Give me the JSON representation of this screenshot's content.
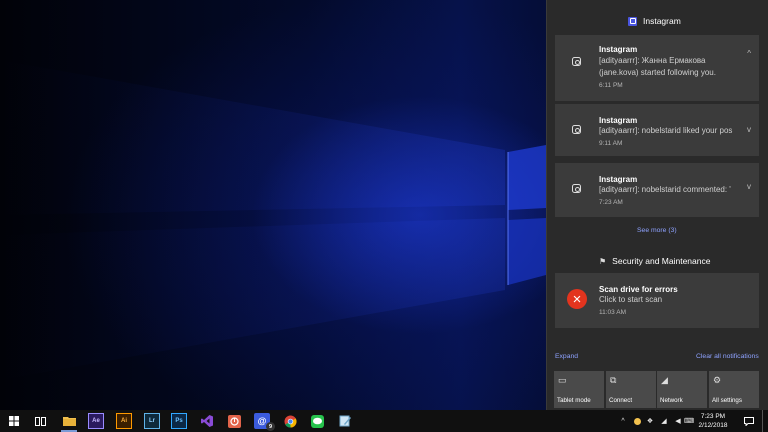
{
  "action_center": {
    "group_instagram": {
      "name": "Instagram",
      "icon": "instagram-app-icon"
    },
    "notifications": [
      {
        "app": "Instagram",
        "line1": "[adityaarrr]: Жанна Ермакова",
        "line2": "(jane.kova) started following you.",
        "time": "6:11 PM",
        "chevron": "^"
      },
      {
        "app": "Instagram",
        "line1": "[adityaarrr]: nobelstarid liked your pos",
        "line2": "",
        "time": "9:11 AM",
        "chevron": "v"
      },
      {
        "app": "Instagram",
        "line1": "[adityaarrr]: nobelstarid commented: '",
        "line2": "",
        "time": "7:23 AM",
        "chevron": "v"
      }
    ],
    "see_more": "See more (3)",
    "group_security": {
      "name": "Security and Maintenance",
      "icon": "flag-icon"
    },
    "security_notification": {
      "title": "Scan drive for errors",
      "body": "Click to start scan",
      "time": "11:03 AM"
    },
    "expand": "Expand",
    "clear_all": "Clear all notifications",
    "quick_actions": [
      {
        "label": "Tablet mode",
        "icon": "tablet-mode-icon"
      },
      {
        "label": "Connect",
        "icon": "connect-icon"
      },
      {
        "label": "Network",
        "icon": "network-icon"
      },
      {
        "label": "All settings",
        "icon": "gear-icon"
      }
    ]
  },
  "taskbar": {
    "apps": [
      {
        "name": "start",
        "icon": "windows-logo-icon",
        "glyph": "",
        "color": "#ffffff"
      },
      {
        "name": "task-view",
        "icon": "task-view-icon",
        "glyph": "",
        "color": "#ffffff"
      },
      {
        "name": "file-explorer",
        "icon": "folder-icon",
        "glyph": "",
        "color": "#f2c14e"
      },
      {
        "name": "after-effects",
        "icon": "after-effects-icon",
        "glyph": "Ae",
        "color": "#2b1a5e"
      },
      {
        "name": "illustrator",
        "icon": "illustrator-icon",
        "glyph": "Ai",
        "color": "#3b1f00"
      },
      {
        "name": "lightroom",
        "icon": "lightroom-icon",
        "glyph": "Lr",
        "color": "#0e2a3a"
      },
      {
        "name": "photoshop",
        "icon": "photoshop-icon",
        "glyph": "Ps",
        "color": "#0b2845"
      },
      {
        "name": "visual-studio",
        "icon": "visual-studio-icon",
        "glyph": "",
        "color": "#7a3fc4"
      },
      {
        "name": "app-orange",
        "icon": "circle-app-icon",
        "glyph": "",
        "color": "#e2644a"
      },
      {
        "name": "mail-app",
        "icon": "at-sign-icon",
        "glyph": "@",
        "color": "#3b5bdb",
        "badge": "9"
      },
      {
        "name": "chrome",
        "icon": "chrome-icon",
        "glyph": "",
        "color": "#db4437"
      },
      {
        "name": "line",
        "icon": "line-chat-icon",
        "glyph": "",
        "color": "#27c24c"
      },
      {
        "name": "notepad-app",
        "icon": "notepad-icon",
        "glyph": "",
        "color": "#6fa6c9"
      }
    ],
    "tray": {
      "clock_time": "7:23 PM",
      "clock_date": "2/12/2018"
    }
  }
}
